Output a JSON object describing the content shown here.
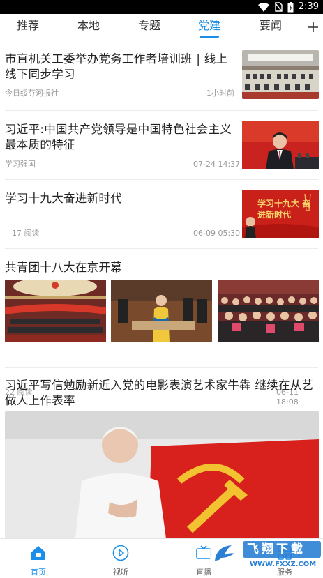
{
  "status_bar": {
    "time": "2:39",
    "icons": [
      "wifi-icon",
      "no-sim-icon",
      "battery-icon"
    ]
  },
  "tabs": [
    {
      "label": "推荐",
      "active": false
    },
    {
      "label": "本地",
      "active": false
    },
    {
      "label": "专题",
      "active": false
    },
    {
      "label": "党建",
      "active": true
    },
    {
      "label": "要闻",
      "active": false
    }
  ],
  "tab_more_icon": "plus-icon",
  "accent": "#1a8ee8",
  "feed": [
    {
      "title": "市直机关工委举办党务工作者培训班 | 线上线下同步学习",
      "source": "今日绥芬河报社",
      "time": "1小时前"
    },
    {
      "title": "习近平:中国共产党领导是中国特色社会主义最本质的特征",
      "source": "学习强国",
      "time": "07-24 14:37"
    },
    {
      "title": "学习十九大奋进新时代",
      "reads": "17 阅读",
      "time": "06-09 05:30",
      "image_text": "学习十九大 奋进新时代"
    },
    {
      "title": "共青团十八大在京开幕",
      "reads": "22 阅读",
      "time": "06-11 18:08"
    },
    {
      "title": "习近平写信勉励新近入党的电影表演艺术家牛犇 继续在从艺做人上作表率"
    }
  ],
  "bottom_nav": [
    {
      "label": "首页",
      "icon": "home-icon",
      "active": true
    },
    {
      "label": "视听",
      "icon": "play-circle-icon",
      "active": false
    },
    {
      "label": "直播",
      "icon": "tv-icon",
      "active": false
    },
    {
      "label": "服务",
      "icon": "grid-icon",
      "active": false
    }
  ],
  "watermark": {
    "brand": "飞翔下载",
    "url": "WWW.FXXZ.COM"
  }
}
